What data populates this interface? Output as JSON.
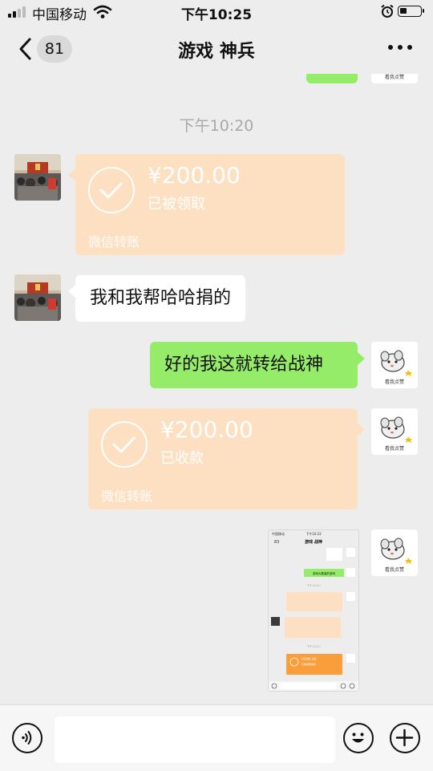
{
  "status_bar": {
    "carrier": "中国移动",
    "time": "下午10:25",
    "battery_level": 0.35
  },
  "nav": {
    "unread_badge": "81",
    "title": "游戏 神兵"
  },
  "chat": {
    "time_divider": "下午10:20",
    "messages": [
      {
        "type": "transfer",
        "sender": "other",
        "amount": "¥200.00",
        "status": "已被领取",
        "footer": "微信转账"
      },
      {
        "type": "text",
        "sender": "other",
        "text": "我和我帮哈哈捐的"
      },
      {
        "type": "text",
        "sender": "self",
        "text": "好的我这就转给战神"
      },
      {
        "type": "transfer",
        "sender": "self",
        "amount": "¥200.00",
        "status": "已收款",
        "footer": "微信转账"
      },
      {
        "type": "image",
        "sender": "self",
        "description": "screenshot"
      }
    ],
    "self_avatar_caption": "看我点赞"
  },
  "screenshot_preview": {
    "carrier": "中国移动",
    "time": "下午10:22",
    "badge": "83",
    "title": "游戏 战神",
    "green_message": "游戏大数量的游戏",
    "time_1": "下午10:00",
    "time_2": "下午10:20",
    "amount": "¥200.00",
    "status": "已被领取收款"
  },
  "colors": {
    "background": "#ededed",
    "green_bubble": "#95ec69",
    "transfer_accepted": "#fde0c2",
    "transfer_pending": "#fa9d3b",
    "text_gray": "#a8a8a8"
  },
  "icons": [
    "signal-icon",
    "wifi-icon",
    "alarm-icon",
    "battery-icon",
    "back-chevron-icon",
    "more-icon",
    "check-icon",
    "voice-icon",
    "emoji-icon",
    "plus-icon"
  ]
}
